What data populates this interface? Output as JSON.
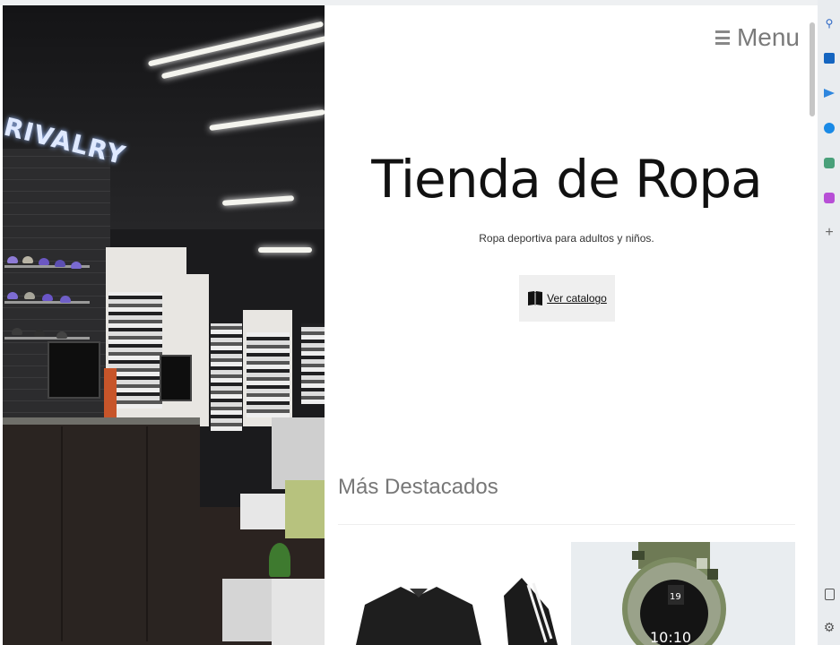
{
  "header": {
    "menu_label": "Menu"
  },
  "hero": {
    "neon_sign": "RIVALRY"
  },
  "main": {
    "title": "Tienda de Ropa",
    "subtitle": "Ropa deportiva para adultos y niños.",
    "catalog_button": "Ver catalogo",
    "section_title": "Más Destacados"
  },
  "products": [
    {
      "name": "track-jacket"
    },
    {
      "name": "sport-watch"
    }
  ],
  "sidebar_icons": [
    "search-icon",
    "outlook-icon",
    "send-icon",
    "skype-icon",
    "chat-icon",
    "games-icon",
    "add-icon",
    "split-screen-icon",
    "settings-icon"
  ]
}
